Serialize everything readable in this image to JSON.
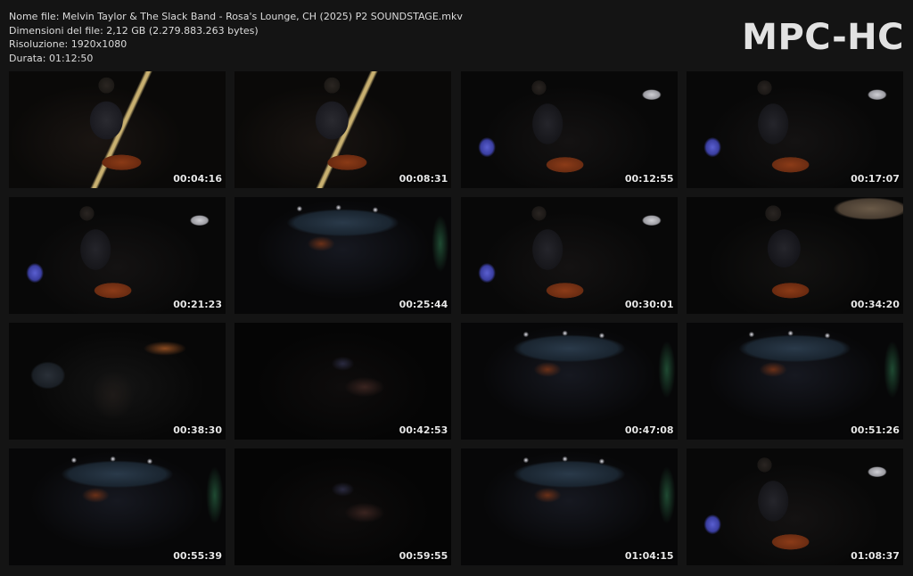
{
  "info": {
    "file_name": "Nome file: Melvin Taylor & The Slack Band -  Rosa's Lounge, CH (2025) P2 SOUNDSTAGE.mkv",
    "file_size": "Dimensioni del file: 2,12 GB (2.279.883.263 bytes)",
    "resolution": "Risoluzione: 1920x1080",
    "duration": "Durata: 01:12:50"
  },
  "logo": "MPC-HC",
  "thumbnails": [
    {
      "time": "00:04:16"
    },
    {
      "time": "00:08:31"
    },
    {
      "time": "00:12:55"
    },
    {
      "time": "00:17:07"
    },
    {
      "time": "00:21:23"
    },
    {
      "time": "00:25:44"
    },
    {
      "time": "00:30:01"
    },
    {
      "time": "00:34:20"
    },
    {
      "time": "00:38:30"
    },
    {
      "time": "00:42:53"
    },
    {
      "time": "00:47:08"
    },
    {
      "time": "00:51:26"
    },
    {
      "time": "00:55:39"
    },
    {
      "time": "00:59:55"
    },
    {
      "time": "01:04:15"
    },
    {
      "time": "01:08:37"
    }
  ]
}
